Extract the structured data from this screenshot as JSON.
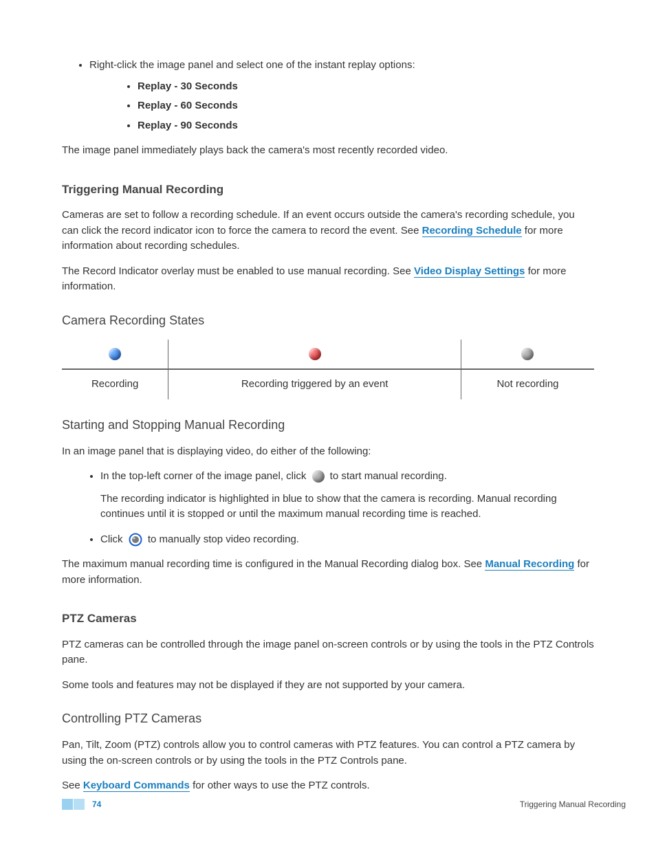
{
  "intro": {
    "rightclick": "Right-click the image panel and select one of the instant replay options:",
    "options": [
      "Replay - 30 Seconds",
      "Replay - 60 Seconds",
      "Replay - 90 Seconds"
    ],
    "followup": "The image panel immediately plays back the camera's most recently recorded video."
  },
  "triggering": {
    "heading": "Triggering Manual Recording",
    "p1a": "Cameras are set to follow a recording schedule. If an event occurs outside the camera's recording schedule, you can click the record indicator icon to force the camera to record the event. See ",
    "link1": "Recording Schedule",
    "p1b": " for more information about recording schedules.",
    "p2a": "The Record Indicator overlay must be enabled to use manual recording. See ",
    "link2": "Video Display Settings",
    "p2b": " for more information."
  },
  "states": {
    "heading": "Camera Recording States",
    "recording": "Recording",
    "triggered": "Recording triggered by an event",
    "notrecording": "Not recording"
  },
  "startstop": {
    "heading": "Starting and Stopping Manual Recording",
    "p1": "In an image panel that is displaying video, do either of the following:",
    "li1a": "In the top-left corner of the image panel, click",
    "li1b": "to start manual recording.",
    "li1follow": "The recording indicator is highlighted in blue to show that the camera is recording. Manual recording continues until it is stopped or until the maximum manual recording time is reached.",
    "li2a": "Click",
    "li2b": "to manually stop video recording.",
    "p2a": "The maximum manual recording time is configured in the Manual Recording dialog box. See ",
    "link3": "Manual Recording",
    "p2b": " for more information."
  },
  "ptz": {
    "heading": "PTZ Cameras",
    "p1": "PTZ cameras can be controlled through the image panel on-screen controls or by using the tools in the PTZ Controls pane.",
    "p2": "Some tools and features may not be displayed if they are not supported by your camera."
  },
  "ptzctrl": {
    "heading": "Controlling PTZ Cameras",
    "p1": "Pan, Tilt, Zoom (PTZ) controls allow you to control cameras with PTZ features. You can control a PTZ camera by using the on-screen controls or by using the tools in the PTZ Controls pane.",
    "p2a": "See ",
    "link4": "Keyboard Commands",
    "p2b": " for other ways to use the PTZ controls."
  },
  "footer": {
    "page": "74",
    "title": "Triggering Manual Recording"
  }
}
